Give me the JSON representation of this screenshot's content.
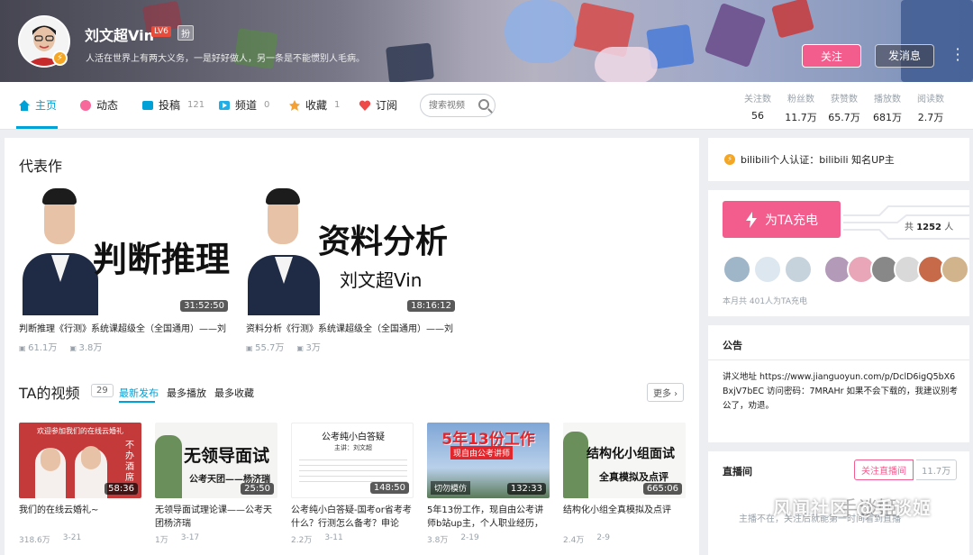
{
  "profile": {
    "name": "刘文超Vin",
    "level": "LV6",
    "fan_badge": "扮",
    "sign": "人活在世界上有两大义务，一是好好做人，另一条是不能惯别人毛病。",
    "follow_label": "关注",
    "message_label": "发消息"
  },
  "nav": {
    "items": [
      {
        "label": "主页",
        "count": ""
      },
      {
        "label": "动态",
        "count": ""
      },
      {
        "label": "投稿",
        "count": "121"
      },
      {
        "label": "频道",
        "count": "0"
      },
      {
        "label": "收藏",
        "count": "1"
      },
      {
        "label": "订阅",
        "count": ""
      }
    ],
    "search_placeholder": "搜索视频",
    "stats": [
      {
        "key": "关注数",
        "value": "56"
      },
      {
        "key": "粉丝数",
        "value": "11.7万"
      },
      {
        "key": "获赞数",
        "value": "65.7万"
      },
      {
        "key": "播放数",
        "value": "681万"
      },
      {
        "key": "阅读数",
        "value": "2.7万"
      }
    ]
  },
  "representative": {
    "title": "代表作",
    "cards": [
      {
        "thumb_text": "判断推理",
        "thumb_sub": "",
        "duration": "31:52:50",
        "title": "判断推理《行测》系统课超级全（全国通用）——刘",
        "plays": "61.1万",
        "danmaku": "3.8万"
      },
      {
        "thumb_text": "资料分析",
        "thumb_sub": "刘文超Vin",
        "duration": "18:16:12",
        "title": "资料分析《行测》系统课超级全（全国通用）——刘",
        "plays": "55.7万",
        "danmaku": "3万"
      }
    ]
  },
  "videos": {
    "title": "TA的视频",
    "count": "29",
    "tabs": [
      "最新发布",
      "最多播放",
      "最多收藏"
    ],
    "more_label": "更多",
    "items": [
      {
        "thumb_text": "欢迎参加我们的在线云婚礼",
        "side_text": "不办酒席",
        "duration": "58:36",
        "title": "我们的在线云婚礼~",
        "plays": "318.6万",
        "date": "3-21"
      },
      {
        "thumb_text": "无领导面试",
        "side_text": "公考天团——杨济瑞",
        "duration": "25:50",
        "title": "无领导面试理论课——公考天团杨济瑞",
        "plays": "1万",
        "date": "3-17"
      },
      {
        "thumb_text": "公考纯小白答疑",
        "side_text": "主讲：刘文超",
        "duration": "148:50",
        "title": "公考纯小白答疑-国考or省考考什么？行测怎么备考？申论",
        "plays": "2.2万",
        "date": "3-11"
      },
      {
        "thumb_text": "5年13份工作",
        "side_text": "现自由公考讲师",
        "duration": "132:33",
        "title": "5年13份工作，现自由公考讲师b站up主，个人职业经历，",
        "plays": "3.8万",
        "date": "2-19"
      },
      {
        "thumb_text": "结构化小组面试",
        "side_text": "全真模拟及点评",
        "duration": "665:06",
        "title": "结构化小组全真模拟及点评",
        "plays": "2.4万",
        "date": "2-9"
      }
    ],
    "thumb_badges": [
      "切勿模仿"
    ]
  },
  "side": {
    "auth_text": "bilibili个人认证：bilibili 知名UP主",
    "charge_label": "为TA充电",
    "charge_total_prefix": "共",
    "charge_total_value": "1252",
    "charge_total_suffix": "人",
    "charge_note": "本月共 401人为TA充电",
    "notice_title": "公告",
    "notice_body": "讲义地址 https://www.jianguoyun.com/p/DclD6igQ5bX6BxjV7bEC 访问密码：7MRAHr 如果不会下载的，我建议别考公了，劝退。",
    "live_title": "直播间",
    "live_follow": "关注直播间",
    "live_count": "11.7万",
    "live_text": "主播不在，关注后就能第一时间看到直播"
  },
  "watermark": {
    "text": "风闻社区 @手谈姬",
    "logo_text": "手谈姬"
  },
  "colors": {
    "accent_blue": "#00a1d6",
    "accent_pink": "#f25d8e",
    "gold": "#f5a623"
  }
}
